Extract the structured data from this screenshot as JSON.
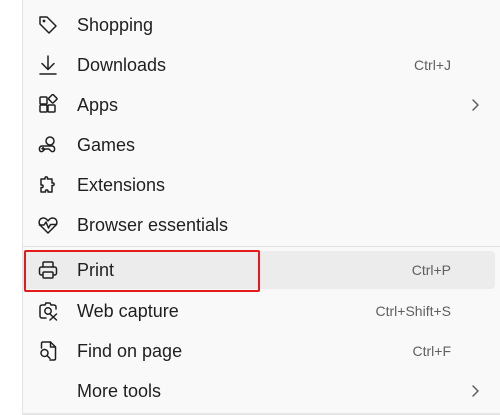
{
  "menu": {
    "items": [
      {
        "label": "Shopping",
        "icon": "tag-icon",
        "shortcut": "",
        "submenu": false
      },
      {
        "label": "Downloads",
        "icon": "download-icon",
        "shortcut": "Ctrl+J",
        "submenu": false
      },
      {
        "label": "Apps",
        "icon": "apps-icon",
        "shortcut": "",
        "submenu": true
      },
      {
        "label": "Games",
        "icon": "games-icon",
        "shortcut": "",
        "submenu": false
      },
      {
        "label": "Extensions",
        "icon": "puzzle-icon",
        "shortcut": "",
        "submenu": false
      },
      {
        "label": "Browser essentials",
        "icon": "heart-pulse-icon",
        "shortcut": "",
        "submenu": false
      },
      {
        "label": "Print",
        "icon": "printer-icon",
        "shortcut": "Ctrl+P",
        "submenu": false,
        "hovered": true,
        "highlighted": true
      },
      {
        "label": "Web capture",
        "icon": "web-capture-icon",
        "shortcut": "Ctrl+Shift+S",
        "submenu": false
      },
      {
        "label": "Find on page",
        "icon": "find-page-icon",
        "shortcut": "Ctrl+F",
        "submenu": false
      },
      {
        "label": "More tools",
        "icon": "",
        "shortcut": "",
        "submenu": true
      }
    ]
  },
  "colors": {
    "menu_background": "#f9f9f9",
    "hover_background": "#ececec",
    "highlight_border": "#e21b1b",
    "text": "#1f1f1f",
    "shortcut_text": "#5f5f5f"
  }
}
